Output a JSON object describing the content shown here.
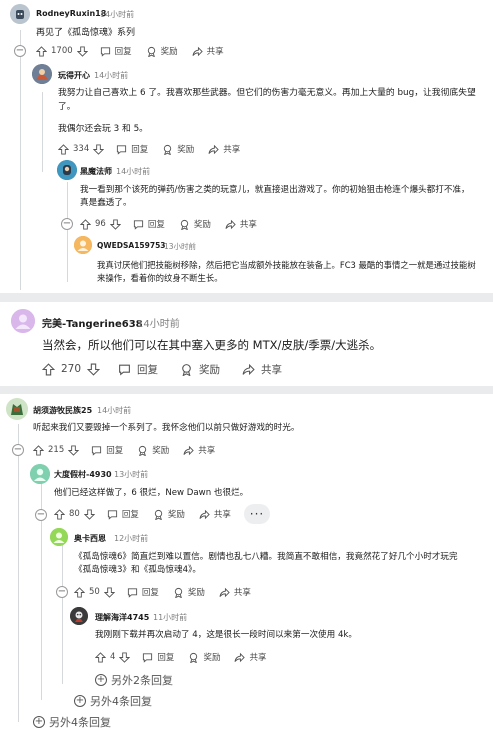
{
  "thread1": {
    "c1": {
      "user": "RodneyRuxin18",
      "time": "14小时前",
      "text": "再见了《孤岛惊魂》系列",
      "votes": "1700",
      "reply": "回复",
      "award": "奖励",
      "share": "共享"
    },
    "c2": {
      "user": "玩得开心",
      "time": "14小时前",
      "text1": "我努力让自己喜欢上 6 了。我喜欢那些武器。但它们的伤害力毫无意义。再加上大量的 bug，让我彻底失望了。",
      "text2": "我偶尔还会玩 3 和 5。",
      "votes": "334",
      "reply": "回复",
      "award": "奖励",
      "share": "共享"
    },
    "c3": {
      "user": "黑魔法师",
      "time": "14小时前",
      "text": "我一看到那个该死的弹药/伤害之类的玩意儿，就直接退出游戏了。你的初始狙击枪连个爆头都打不准，真是蠢透了。",
      "votes": "96",
      "reply": "回复",
      "award": "奖励",
      "share": "共享"
    },
    "c4": {
      "user": "QWEDSA159753",
      "time": "13小时前",
      "text": "我真讨厌他们把技能树移除，然后把它当成额外技能放在装备上。FC3 最酷的事情之一就是通过技能树来操作，看着你的纹身不断生长。"
    }
  },
  "post2": {
    "user": "完美-Tangerine638",
    "time": "14小时前",
    "text": "当然会，所以他们可以在其中塞入更多的 MTX/皮肤/季票/大逃杀。",
    "votes": "270",
    "reply": "回复",
    "award": "奖励",
    "share": "共享"
  },
  "thread3": {
    "c1": {
      "user": "胡须游牧民族25",
      "time": "14小时前",
      "text": "听起来我们又要毁掉一个系列了。我怀念他们以前只做好游戏的时光。",
      "votes": "215",
      "reply": "回复",
      "award": "奖励",
      "share": "共享"
    },
    "c2": {
      "user": "大度假村-4930",
      "time": "13小时前",
      "text": "他们已经这样做了，6 很烂，New Dawn 也很烂。",
      "votes": "80",
      "reply": "回复",
      "award": "奖励",
      "share": "共享",
      "more": "···"
    },
    "c3": {
      "user": "奥卡西恩",
      "time": "12小时前",
      "text": "《孤岛惊魂6》简直烂到难以置信。剧情也乱七八糟。我简直不敢相信，我竟然花了好几个小时才玩完《孤岛惊魂3》和《孤岛惊魂4》。",
      "votes": "50",
      "reply": "回复",
      "award": "奖励",
      "share": "共享"
    },
    "c4": {
      "user": "理解海洋4745",
      "time": "11小时前",
      "text": "我刚刚下载并再次启动了 4，这是很长一段时间以来第一次使用 4k。",
      "votes": "4",
      "reply": "回复",
      "award": "奖励",
      "share": "共享"
    },
    "more_a": "另外2条回复",
    "more_b": "另外4条回复",
    "more_c": "另外4条回复"
  },
  "colors": {
    "divider": "#e9ebed",
    "thread": "#d6d9dc",
    "text": "#1c1c1c",
    "meta": "#7c7c7c"
  },
  "icons": [
    "upvote-icon",
    "downvote-icon",
    "comment-icon",
    "award-icon",
    "share-icon",
    "plus-circle-icon",
    "minus-circle-icon",
    "more-dots-icon"
  ]
}
